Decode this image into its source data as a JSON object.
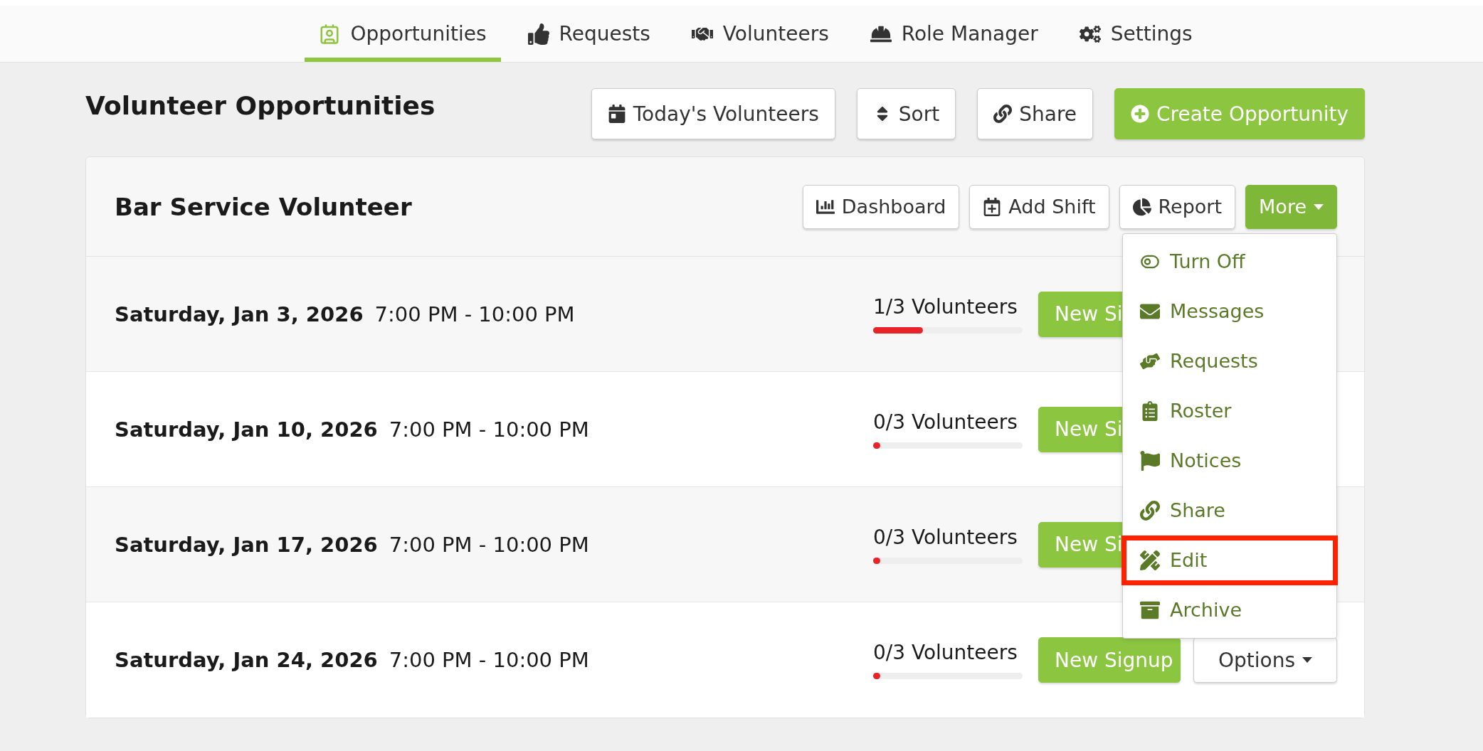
{
  "nav": {
    "tabs": [
      {
        "label": "Opportunities",
        "selected": true
      },
      {
        "label": "Requests",
        "selected": false
      },
      {
        "label": "Volunteers",
        "selected": false
      },
      {
        "label": "Role Manager",
        "selected": false
      },
      {
        "label": "Settings",
        "selected": false
      }
    ]
  },
  "page": {
    "title": "Volunteer Opportunities",
    "actions": [
      {
        "label": "Today's Volunteers",
        "primary": false
      },
      {
        "label": "Sort",
        "primary": false
      },
      {
        "label": "Share",
        "primary": false
      },
      {
        "label": "Create Opportunity",
        "primary": true
      }
    ]
  },
  "card": {
    "title": "Bar Service Volunteer",
    "actions": [
      {
        "label": "Dashboard"
      },
      {
        "label": "Add Shift"
      },
      {
        "label": "Report"
      }
    ],
    "more": {
      "label": "More",
      "expanded": true,
      "items": [
        {
          "label": "Turn Off",
          "highlighted": false
        },
        {
          "label": "Messages",
          "highlighted": false
        },
        {
          "label": "Requests",
          "highlighted": false
        },
        {
          "label": "Roster",
          "highlighted": false
        },
        {
          "label": "Notices",
          "highlighted": false
        },
        {
          "label": "Share",
          "highlighted": false
        },
        {
          "label": "Edit",
          "highlighted": true
        },
        {
          "label": "Archive",
          "highlighted": false
        }
      ]
    },
    "shifts": [
      {
        "date": "Saturday, Jan 3, 2026",
        "time": "7:00 PM - 10:00 PM",
        "count": "1/3 Volunteers",
        "level": 0.333,
        "signup": "New Si"
      },
      {
        "date": "Saturday, Jan 10, 2026",
        "time": "7:00 PM - 10:00 PM",
        "count": "0/3 Volunteers",
        "level": 0,
        "signup": "New Si"
      },
      {
        "date": "Saturday, Jan 17, 2026",
        "time": "7:00 PM - 10:00 PM",
        "count": "0/3 Volunteers",
        "level": 0,
        "signup": "New Si"
      },
      {
        "date": "Saturday, Jan 24, 2026",
        "time": "7:00 PM - 10:00 PM",
        "count": "0/3 Volunteers",
        "level": 0,
        "signup": "New Signup",
        "options": "Options"
      }
    ]
  }
}
